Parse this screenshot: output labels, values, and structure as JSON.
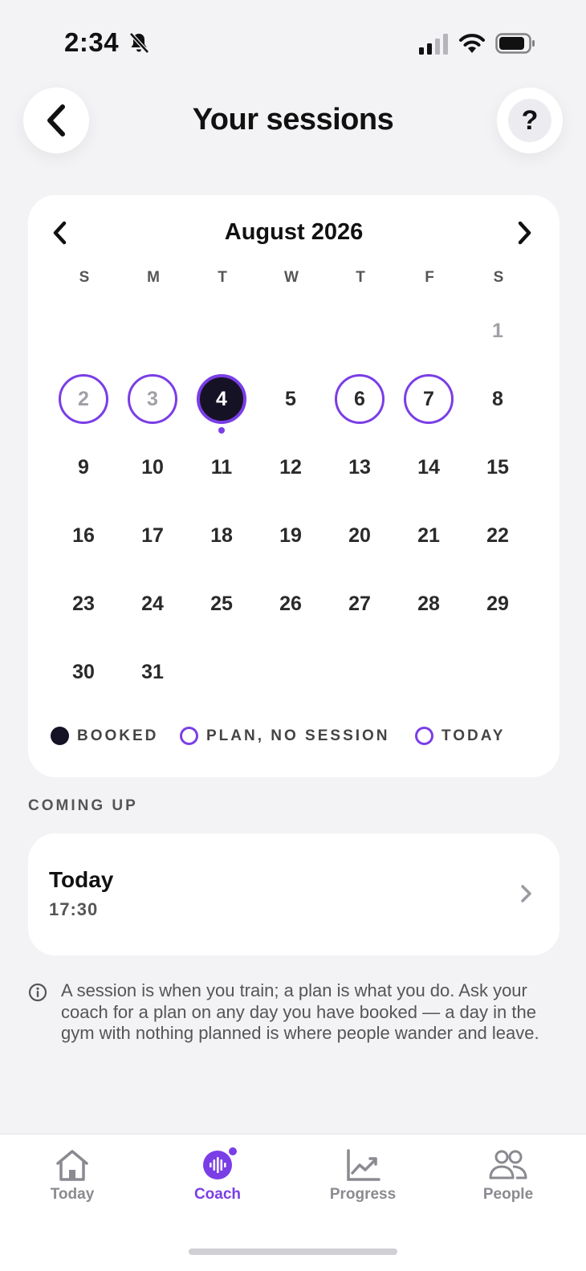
{
  "status": {
    "time": "2:34"
  },
  "header": {
    "title": "Your sessions",
    "help_label": "?"
  },
  "calendar": {
    "month": "August 2026",
    "weekdays": [
      "S",
      "M",
      "T",
      "W",
      "T",
      "F",
      "S"
    ],
    "first_weekday_index": 6,
    "days_in_month": 31,
    "past_days": [
      1,
      2,
      3
    ],
    "plan_no_session_days": [
      2,
      3,
      6,
      7
    ],
    "booked_days": [
      4
    ],
    "today": 4,
    "legend": {
      "booked": "BOOKED",
      "plan_no_session": "PLAN, NO SESSION",
      "today": "TODAY"
    }
  },
  "coming_up": {
    "label": "COMING UP",
    "sessions": [
      {
        "day": "Today",
        "time": "17:30"
      }
    ]
  },
  "info": {
    "text": "A session is when you train; a plan is what you do. Ask your coach for a plan on any day you have booked — a day in the gym with nothing planned is where people wander and leave."
  },
  "tabs": [
    {
      "label": "Today",
      "icon": "home-icon",
      "active": false
    },
    {
      "label": "Coach",
      "icon": "coach-voice-icon",
      "active": true
    },
    {
      "label": "Progress",
      "icon": "chart-icon",
      "active": false
    },
    {
      "label": "People",
      "icon": "people-icon",
      "active": false
    }
  ],
  "colors": {
    "accent": "#7a3ee6",
    "booked": "#151225",
    "background": "#f3f3f6"
  }
}
